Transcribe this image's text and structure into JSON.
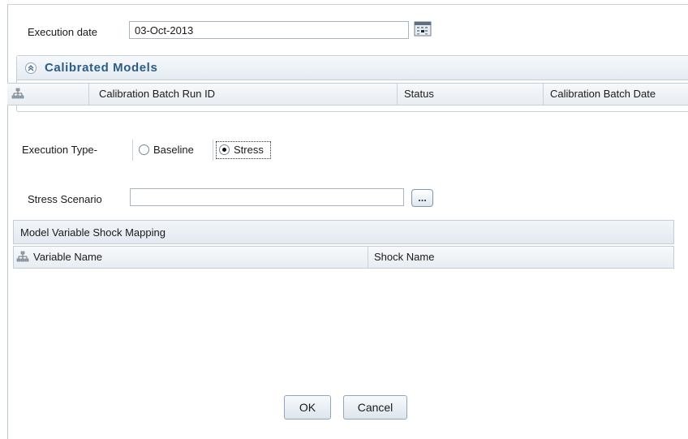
{
  "execution_date": {
    "label": "Execution date",
    "value": "03-Oct-2013",
    "calendar_icon": "calendar-icon"
  },
  "calibrated_models": {
    "title": "Calibrated Models",
    "toggle_icon": "collapse-icon",
    "grid_icon": "tree-icon",
    "columns": [
      "Calibration Batch Run ID",
      "Status",
      "Calibration Batch Date"
    ]
  },
  "execution_type": {
    "label": "Execution Type-",
    "options": [
      "Baseline",
      "Stress"
    ],
    "selected": "Stress"
  },
  "stress_scenario": {
    "label": "Stress Scenario",
    "value": "",
    "browse_label": "..."
  },
  "model_variable_shock_mapping": {
    "title": "Model Variable Shock Mapping",
    "grid_icon": "tree-icon",
    "columns": [
      "Variable Name",
      "Shock Name"
    ]
  },
  "buttons": {
    "ok": "OK",
    "cancel": "Cancel"
  },
  "colors": {
    "panel_title": "#2b5d86",
    "border": "#c3ced9",
    "header_bg": "#e4ebf2"
  }
}
